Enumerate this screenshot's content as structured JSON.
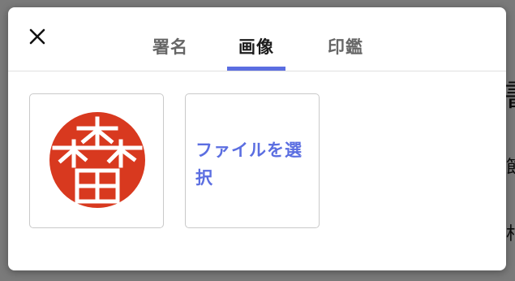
{
  "dialog": {
    "tabs": [
      {
        "label": "署名",
        "active": false
      },
      {
        "label": "画像",
        "active": true
      },
      {
        "label": "印鑑",
        "active": false
      }
    ],
    "close_icon": "close-icon"
  },
  "images": {
    "stamp": {
      "icon": "seal-stamp-image",
      "text": "森田",
      "color": "#d8391f"
    },
    "upload_label": "ファイルを選択"
  },
  "background": {
    "edge_glyphs": [
      "書",
      "節",
      "村"
    ]
  },
  "colors": {
    "accent": "#5b6ee1",
    "overlay": "#7b7b7b",
    "stamp_red": "#d8391f"
  }
}
